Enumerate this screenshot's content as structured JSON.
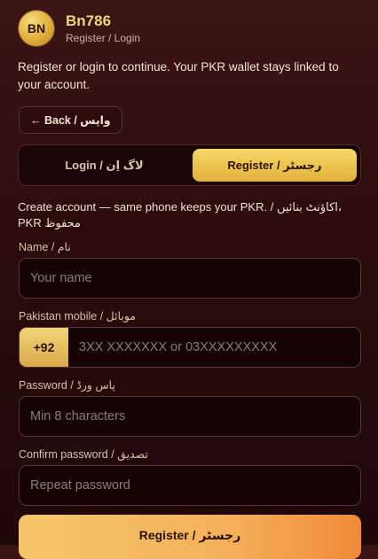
{
  "header": {
    "logo_text": "BN",
    "brand_name": "Bn786",
    "subtitle": "Register / Login"
  },
  "intro_text": "Register or login to continue. Your PKR wallet stays linked to your account.",
  "back_button": "← Back / واپس",
  "tabs": [
    {
      "label": "Login / لاگ اِن",
      "active": false
    },
    {
      "label": "Register / رجسٹر",
      "active": true
    }
  ],
  "create_text": "Create account — same phone keeps your PKR. / اکاؤنٹ بنائیں، PKR محفوظ",
  "fields": {
    "name": {
      "label": "Name / نام",
      "placeholder": "Your name",
      "value": ""
    },
    "mobile": {
      "label": "Pakistan mobile / موبائل",
      "prefix": "+92",
      "placeholder": "3XX XXXXXXX or 03XXXXXXXXX",
      "value": ""
    },
    "password": {
      "label": "Password / پاس ورڈ",
      "placeholder": "Min 8 characters",
      "value": ""
    },
    "confirm": {
      "label": "Confirm password / تصدیق",
      "placeholder": "Repeat password",
      "value": ""
    }
  },
  "submit_label": "Register / رجسٹر",
  "colors": {
    "accent_gold": "#f1d57a",
    "background": "#2a0c0c",
    "button_gradient_end": "#f08a3a"
  }
}
